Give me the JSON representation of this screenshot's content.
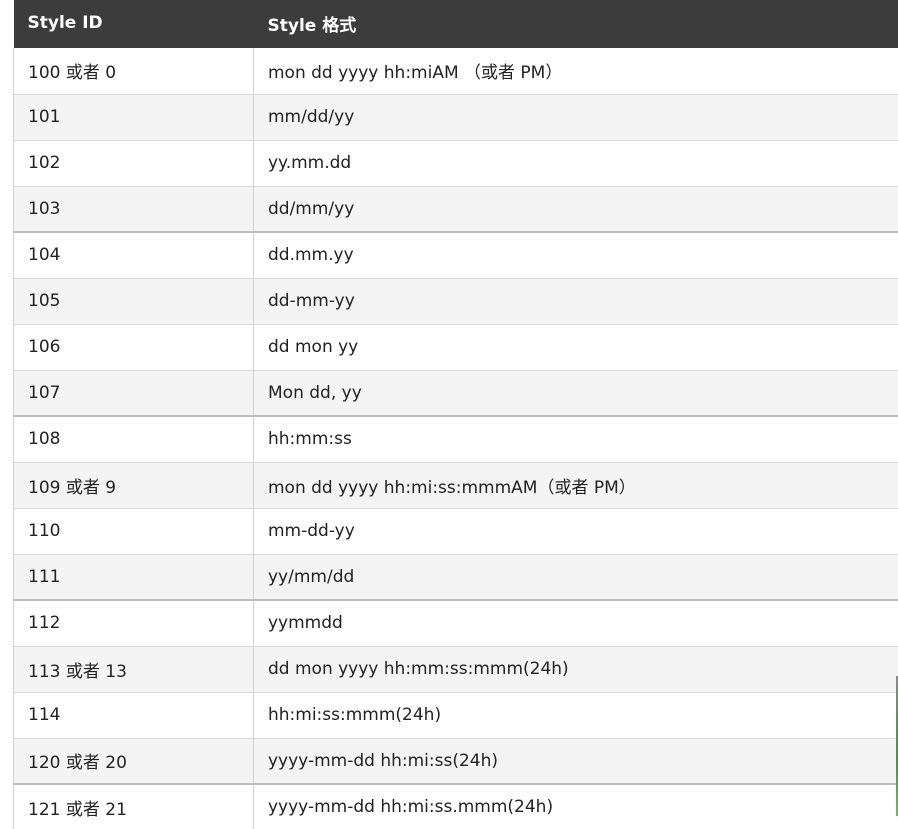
{
  "table": {
    "headers": [
      "Style ID",
      "Style 格式"
    ],
    "rows": [
      [
        "100 或者 0",
        "mon dd yyyy hh:miAM （或者 PM）"
      ],
      [
        "101",
        "mm/dd/yy"
      ],
      [
        "102",
        "yy.mm.dd"
      ],
      [
        "103",
        "dd/mm/yy"
      ],
      [
        "104",
        "dd.mm.yy"
      ],
      [
        "105",
        "dd-mm-yy"
      ],
      [
        "106",
        "dd mon yy"
      ],
      [
        "107",
        "Mon dd, yy"
      ],
      [
        "108",
        "hh:mm:ss"
      ],
      [
        "109 或者 9",
        "mon dd yyyy hh:mi:ss:mmmAM（或者 PM）"
      ],
      [
        "110",
        "mm-dd-yy"
      ],
      [
        "111",
        "yy/mm/dd"
      ],
      [
        "112",
        "yymmdd"
      ],
      [
        "113 或者 13",
        "dd mon yyyy hh:mm:ss:mmm(24h)"
      ],
      [
        "114",
        "hh:mi:ss:mmm(24h)"
      ],
      [
        "120 或者 20",
        "yyyy-mm-dd hh:mi:ss(24h)"
      ],
      [
        "121 或者 21",
        "yyyy-mm-dd hh:mi:ss.mmm(24h)"
      ]
    ]
  }
}
